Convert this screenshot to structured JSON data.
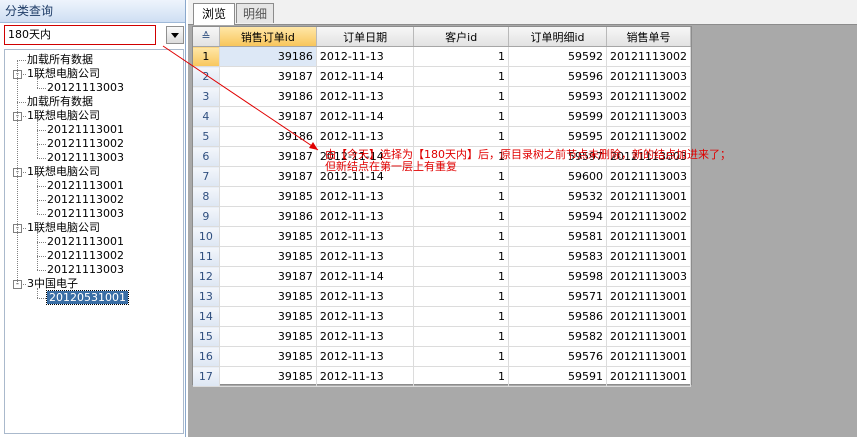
{
  "left_panel": {
    "title": "分类查询",
    "filter_value": "180天内"
  },
  "tree": [
    {
      "label": "加载所有数据",
      "level": 1
    },
    {
      "label": "1联想电脑公司",
      "level": 1,
      "expander": "-"
    },
    {
      "label": "20121113003",
      "level": 2
    },
    {
      "label": "加载所有数据",
      "level": 1
    },
    {
      "label": "1联想电脑公司",
      "level": 1,
      "expander": "-"
    },
    {
      "label": "20121113001",
      "level": 2
    },
    {
      "label": "20121113002",
      "level": 2
    },
    {
      "label": "20121113003",
      "level": 2
    },
    {
      "label": "1联想电脑公司",
      "level": 1,
      "expander": "-"
    },
    {
      "label": "20121113001",
      "level": 2
    },
    {
      "label": "20121113002",
      "level": 2
    },
    {
      "label": "20121113003",
      "level": 2
    },
    {
      "label": "1联想电脑公司",
      "level": 1,
      "expander": "-"
    },
    {
      "label": "20121113001",
      "level": 2
    },
    {
      "label": "20121113002",
      "level": 2
    },
    {
      "label": "20121113003",
      "level": 2
    },
    {
      "label": "3中国电子",
      "level": 1,
      "expander": "-"
    },
    {
      "label": "20120531001",
      "level": 2,
      "selected": true
    }
  ],
  "tabs": [
    {
      "label": "浏览",
      "active": true
    },
    {
      "label": "明细",
      "active": false
    }
  ],
  "grid": {
    "row_header_symbol": "≙",
    "columns": [
      "销售订单id",
      "订单日期",
      "客户id",
      "订单明细id",
      "销售单号"
    ],
    "rows": [
      [
        "1",
        "39186",
        "2012-11-13",
        "1",
        "59592",
        "20121113002"
      ],
      [
        "2",
        "39187",
        "2012-11-14",
        "1",
        "59596",
        "20121113003"
      ],
      [
        "3",
        "39186",
        "2012-11-13",
        "1",
        "59593",
        "20121113002"
      ],
      [
        "4",
        "39187",
        "2012-11-14",
        "1",
        "59599",
        "20121113003"
      ],
      [
        "5",
        "39186",
        "2012-11-13",
        "1",
        "59595",
        "20121113002"
      ],
      [
        "6",
        "39187",
        "2012-11-14",
        "1",
        "59597",
        "20121113003"
      ],
      [
        "7",
        "39187",
        "2012-11-14",
        "1",
        "59600",
        "20121113003"
      ],
      [
        "8",
        "39185",
        "2012-11-13",
        "1",
        "59532",
        "20121113001"
      ],
      [
        "9",
        "39186",
        "2012-11-13",
        "1",
        "59594",
        "20121113002"
      ],
      [
        "10",
        "39185",
        "2012-11-13",
        "1",
        "59581",
        "20121113001"
      ],
      [
        "11",
        "39185",
        "2012-11-13",
        "1",
        "59583",
        "20121113001"
      ],
      [
        "12",
        "39187",
        "2012-11-14",
        "1",
        "59598",
        "20121113003"
      ],
      [
        "13",
        "39185",
        "2012-11-13",
        "1",
        "59571",
        "20121113001"
      ],
      [
        "14",
        "39185",
        "2012-11-13",
        "1",
        "59586",
        "20121113001"
      ],
      [
        "15",
        "39185",
        "2012-11-13",
        "1",
        "59582",
        "20121113001"
      ],
      [
        "16",
        "39185",
        "2012-11-13",
        "1",
        "59576",
        "20121113001"
      ],
      [
        "17",
        "39185",
        "2012-11-13",
        "1",
        "59591",
        "20121113001"
      ]
    ]
  },
  "annotation": {
    "line1": "由【今天】选择为【180天内】后，原目录树之前节点未删除，新的结点加进来了；",
    "line2": "但新结点在第一层上有重复",
    "color": "#e00000"
  }
}
